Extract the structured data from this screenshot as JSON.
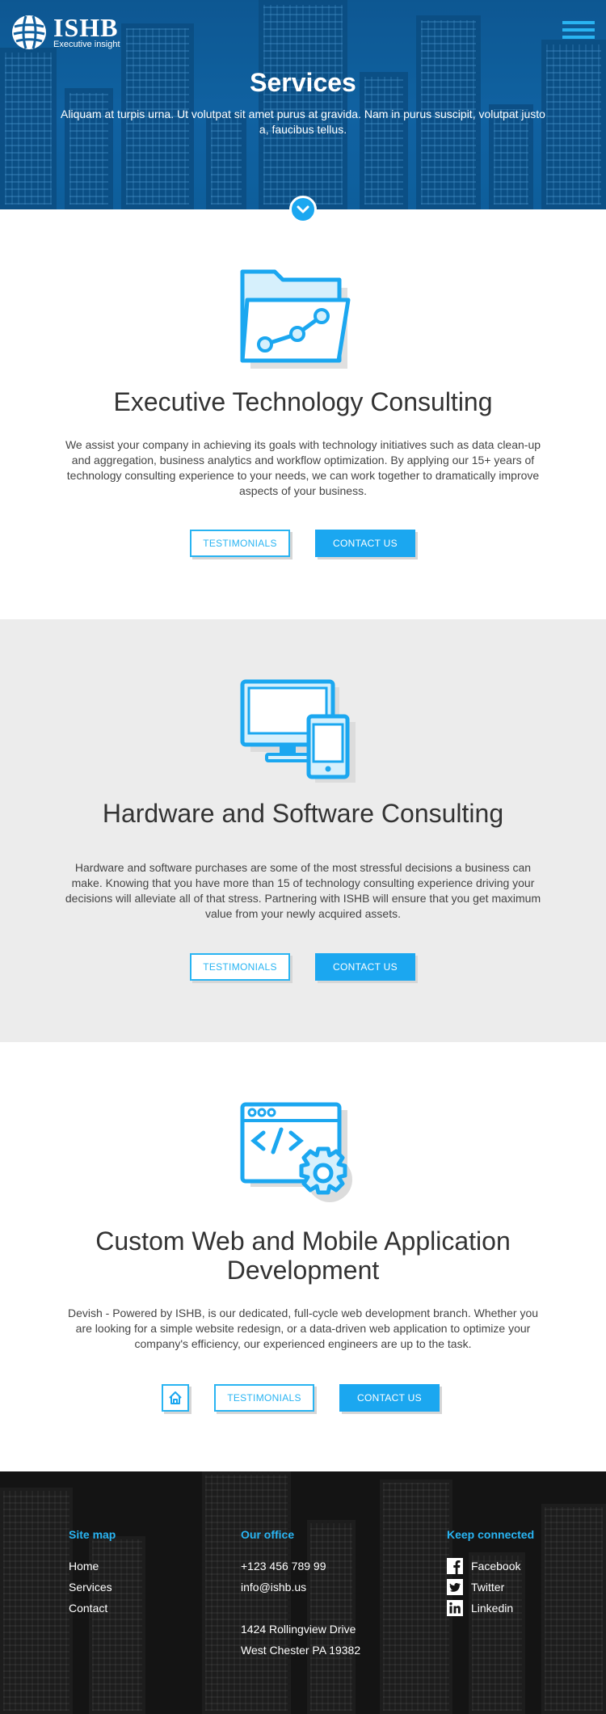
{
  "header": {
    "logo_name": "ISHB",
    "logo_tagline": "Executive insight",
    "title": "Services",
    "subtitle": "Aliquam at turpis urna. Ut volutpat sit amet purus at gravida. Nam in purus suscipit, volutpat justo a, faucibus tellus."
  },
  "services": [
    {
      "icon": "folder-chart-icon",
      "title": "Executive Technology Consulting",
      "text": "We assist your company in achieving its goals with technology initiatives such as  data clean-up and aggregation, business analytics and workflow optimization. By applying our 15+ years of technology consulting experience to your needs, we can work together to dramatically improve aspects of your business.",
      "testimonials_label": "TESTIMONIALS",
      "contact_label": "CONTACT US"
    },
    {
      "icon": "desktop-mobile-icon",
      "title": "Hardware and Software Consulting",
      "text": "Hardware and software purchases are some of the most stressful decisions a business can make. Knowing that you have more than 15 of technology consulting experience driving your decisions will alleviate all of that stress. Partnering with ISHB will ensure that you get maximum value from your newly acquired assets.",
      "testimonials_label": "TESTIMONIALS",
      "contact_label": "CONTACT US"
    },
    {
      "icon": "code-window-gear-icon",
      "title": "Custom Web and Mobile Application Development",
      "text": "Devish - Powered by ISHB, is our dedicated, full-cycle web development branch. Whether you are looking for a simple website redesign, or a data-driven web application to optimize your company's efficiency, our experienced engineers are up to the task.",
      "testimonials_label": "TESTIMONIALS",
      "contact_label": "CONTACT US"
    }
  ],
  "footer": {
    "sitemap": {
      "heading": "Site map",
      "links": [
        "Home",
        "Services",
        "Contact"
      ]
    },
    "office": {
      "heading": "Our office",
      "phone": "+123 456 789 99",
      "email": "info@ishb.us",
      "address_line1": "1424 Rollingview Drive",
      "address_line2": "West Chester PA 19382"
    },
    "connect": {
      "heading": "Keep connected",
      "items": [
        {
          "label": "Facebook",
          "icon": "facebook-icon"
        },
        {
          "label": "Twitter",
          "icon": "twitter-icon"
        },
        {
          "label": "Linkedin",
          "icon": "linkedin-icon"
        }
      ]
    }
  },
  "colors": {
    "accent": "#1ba7f0",
    "hero_blue": "#11609e",
    "section_gray": "#ececec",
    "footer_dark": "#141414"
  }
}
